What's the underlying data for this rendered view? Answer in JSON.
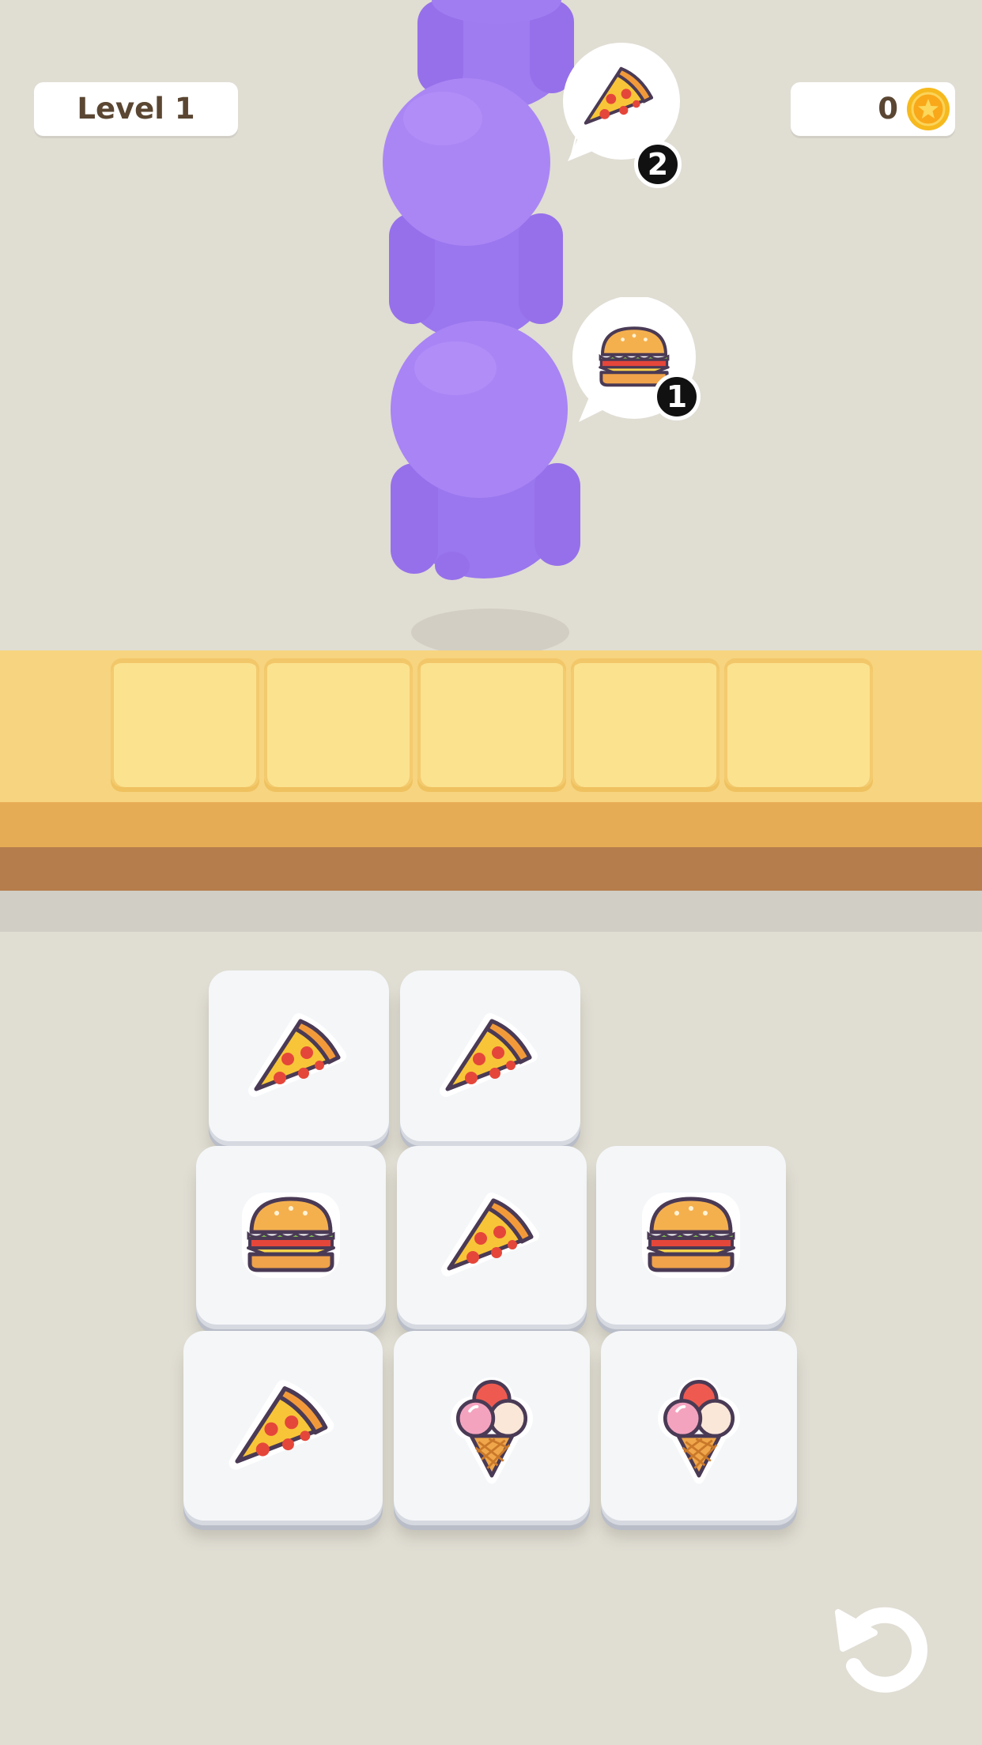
{
  "hud": {
    "level_label": "Level 1",
    "coin_count": "0"
  },
  "customers": [
    {
      "order_icon": "pizza-icon",
      "queue_number": "2"
    },
    {
      "order_icon": "burger-icon",
      "queue_number": "1"
    }
  ],
  "tray_slots": [
    "",
    "",
    "",
    "",
    ""
  ],
  "tiles": [
    {
      "row": 1,
      "col": 1,
      "item": "pizza-icon"
    },
    {
      "row": 1,
      "col": 2,
      "item": "pizza-icon"
    },
    {
      "row": 2,
      "col": 1,
      "item": "burger-icon"
    },
    {
      "row": 2,
      "col": 2,
      "item": "pizza-icon"
    },
    {
      "row": 2,
      "col": 3,
      "item": "burger-icon"
    },
    {
      "row": 3,
      "col": 1,
      "item": "pizza-icon"
    },
    {
      "row": 3,
      "col": 2,
      "item": "ice-cream-icon"
    },
    {
      "row": 3,
      "col": 3,
      "item": "ice-cream-icon"
    }
  ],
  "colors": {
    "background": "#e0ddd3",
    "customer": "#a27cf2",
    "counter_top": "#f7d47f",
    "counter_front": "#e6ac55",
    "counter_base": "#b57c4c",
    "coin": "#f6b91e"
  },
  "icons": {
    "undo": "undo-icon",
    "coin": "coin-icon"
  }
}
